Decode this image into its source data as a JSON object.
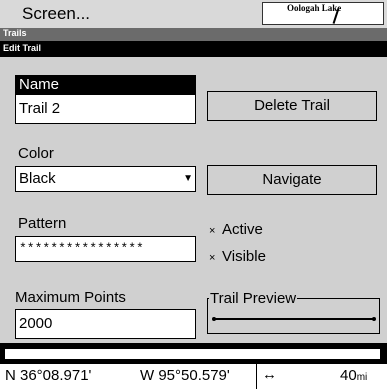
{
  "header": {
    "menu_title": "Screen...",
    "map_label": "Oologah Lake"
  },
  "trails_bar": {
    "label": "Trails"
  },
  "edit_bar": {
    "label": "Edit Trail"
  },
  "form": {
    "name_label": "Name",
    "name_value": "Trail 2",
    "delete_button": "Delete Trail",
    "color_label": "Color",
    "color_value": "Black",
    "navigate_button": "Navigate",
    "pattern_label": "Pattern",
    "pattern_value": "****************",
    "active_label": "Active",
    "active_checked": true,
    "visible_label": "Visible",
    "visible_checked": true,
    "max_points_label": "Maximum Points",
    "max_points_value": "2000",
    "trail_preview_label": "Trail Preview"
  },
  "status": {
    "lat": "N   36°08.971'",
    "lon": "W   95°50.579'",
    "range": "40",
    "range_unit": "mi",
    "range_icon": "double-arrow-icon"
  },
  "icons": {
    "checkbox_mark": "×"
  }
}
